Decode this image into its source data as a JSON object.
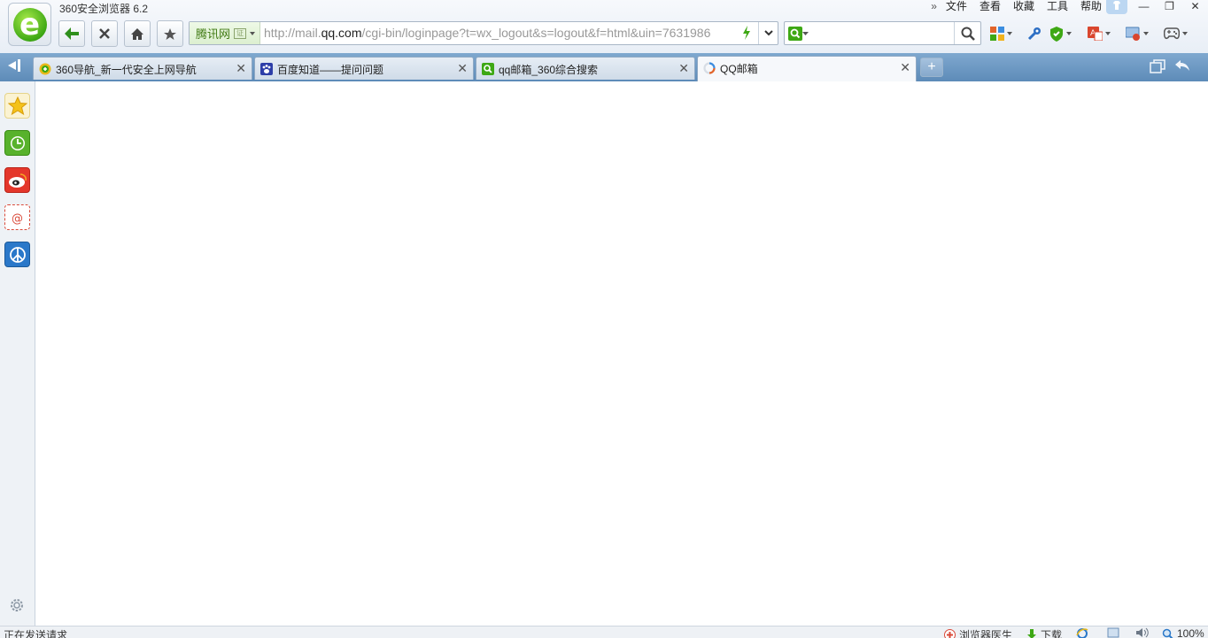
{
  "app": {
    "title": "360安全浏览器 6.2"
  },
  "menu": {
    "overflow": "»",
    "items": [
      {
        "label": "文件"
      },
      {
        "label": "查看"
      },
      {
        "label": "收藏"
      },
      {
        "label": "工具"
      },
      {
        "label": "帮助"
      }
    ]
  },
  "window": {
    "minimize": "—",
    "restore": "❐",
    "close": "✕"
  },
  "address": {
    "site_identity": "腾讯网",
    "cert_badge": "证",
    "url_prefix": "http://mail.",
    "url_domain": "qq.com",
    "url_rest": "/cgi-bin/loginpage?t=wx_logout&s=logout&f=html&uin=7631986"
  },
  "search": {
    "value": ""
  },
  "tabs": [
    {
      "title": "360导航_新一代安全上网导航",
      "close": "✕"
    },
    {
      "title": "百度知道——提问问题",
      "close": "✕"
    },
    {
      "title": "qq邮箱_360综合搜索",
      "close": "✕"
    },
    {
      "title": "QQ邮箱",
      "close": "✕"
    }
  ],
  "new_tab_label": "+",
  "status": {
    "text": "正在发送请求",
    "doctor": "浏览器医生",
    "download": "下载",
    "zoom": "100%"
  },
  "colors": {
    "tabbar": "#6b96c2",
    "accent_green": "#3ea814",
    "sidebar_bg": "#eef2f6"
  },
  "icons": {
    "logo": "360-browser-e-logo",
    "back": "back-arrow-icon",
    "stop": "stop-icon",
    "home": "home-icon",
    "favorite": "star-icon"
  }
}
